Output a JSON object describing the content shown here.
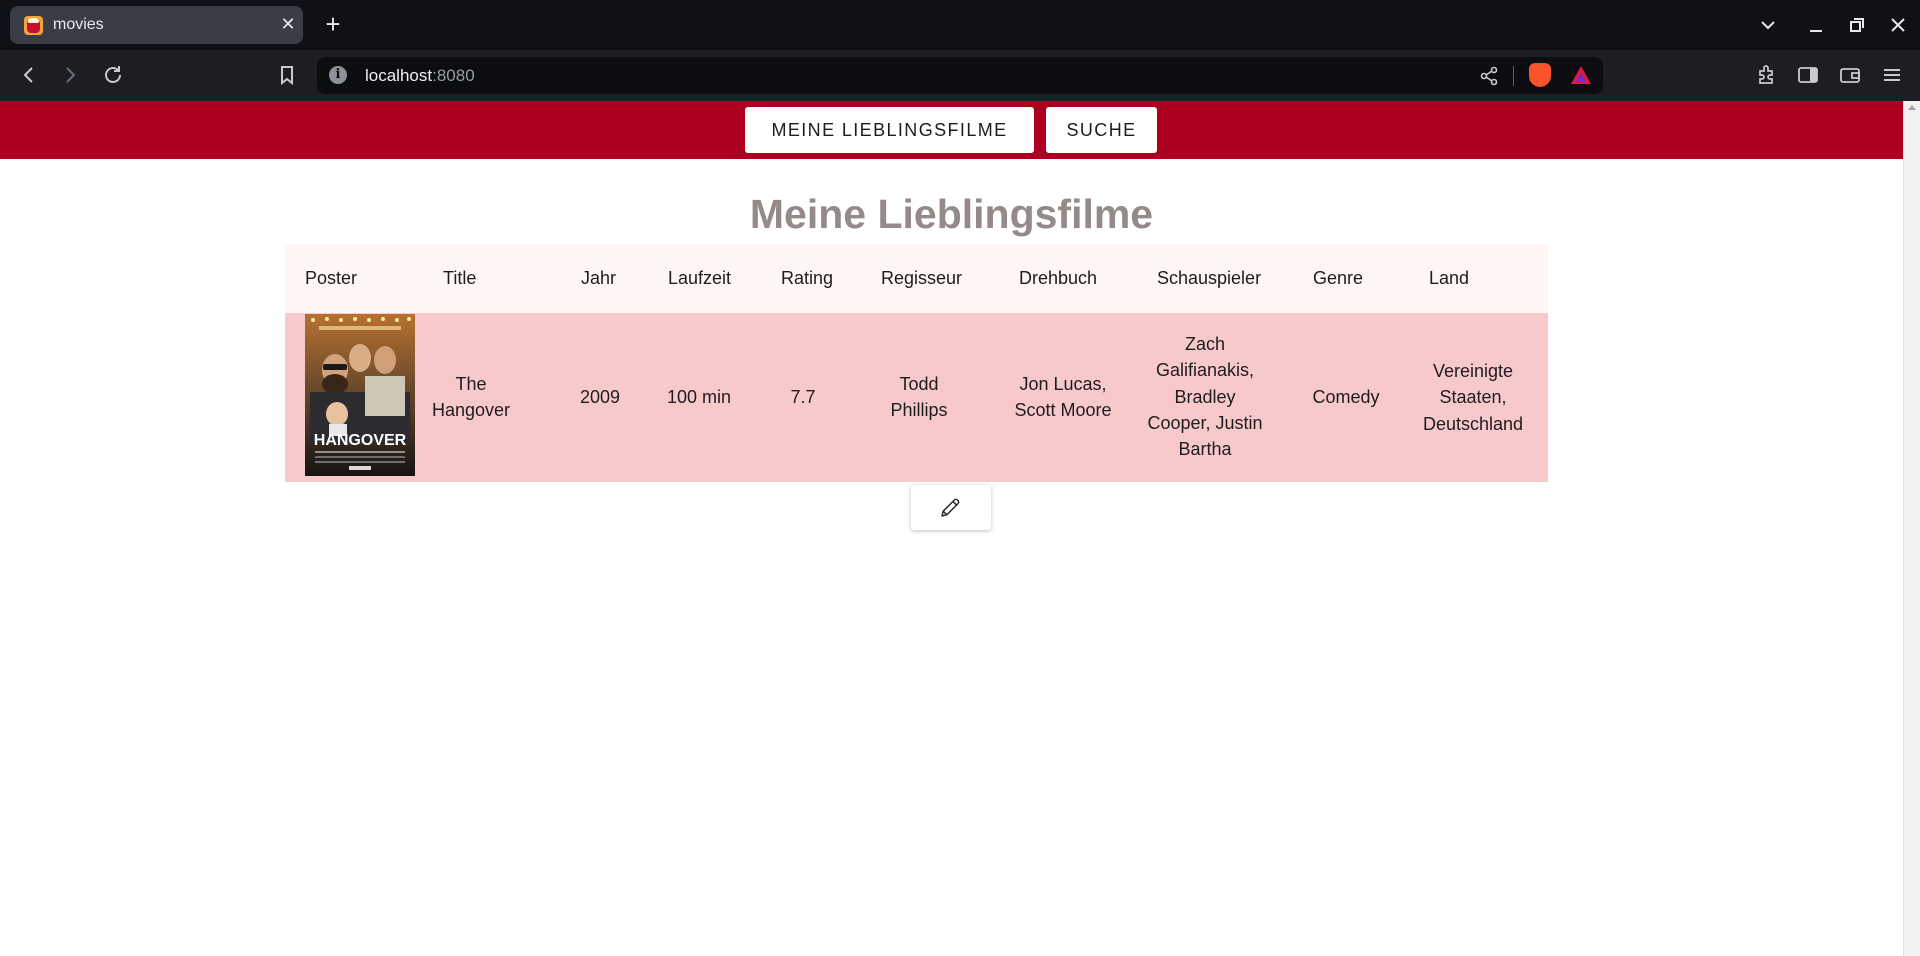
{
  "browser": {
    "tab_title": "movies",
    "tab_close": "✕",
    "new_tab": "+",
    "url_host": "localhost",
    "url_port": ":8080",
    "url_info": "i"
  },
  "nav": {
    "favorites_label": "MEINE LIEBLINGSFILME",
    "search_label": "SUCHE"
  },
  "page": {
    "heading": "Meine Lieblingsfilme"
  },
  "table": {
    "columns": [
      "Poster",
      "Title",
      "Jahr",
      "Laufzeit",
      "Rating",
      "Regisseur",
      "Drehbuch",
      "Schauspieler",
      "Genre",
      "Land"
    ],
    "rows": [
      {
        "poster": "HANGOVER",
        "title": "The Hangover",
        "year": "2009",
        "runtime": "100 min",
        "rating": "7.7",
        "director": "Todd Phillips",
        "writer": "Jon Lucas, Scott Moore",
        "actors": "Zach Galifianakis, Bradley Cooper, Justin Bartha",
        "genre": "Comedy",
        "country": "Vereinigte Staaten, Deutschland"
      }
    ]
  },
  "icons": {
    "edit": "pencil-icon",
    "favicon": "popcorn-icon"
  },
  "colors": {
    "navbar": "#ad0020",
    "header_row": "#fff5f5",
    "data_row": "#f8c9cb",
    "heading": "#958a8a"
  }
}
